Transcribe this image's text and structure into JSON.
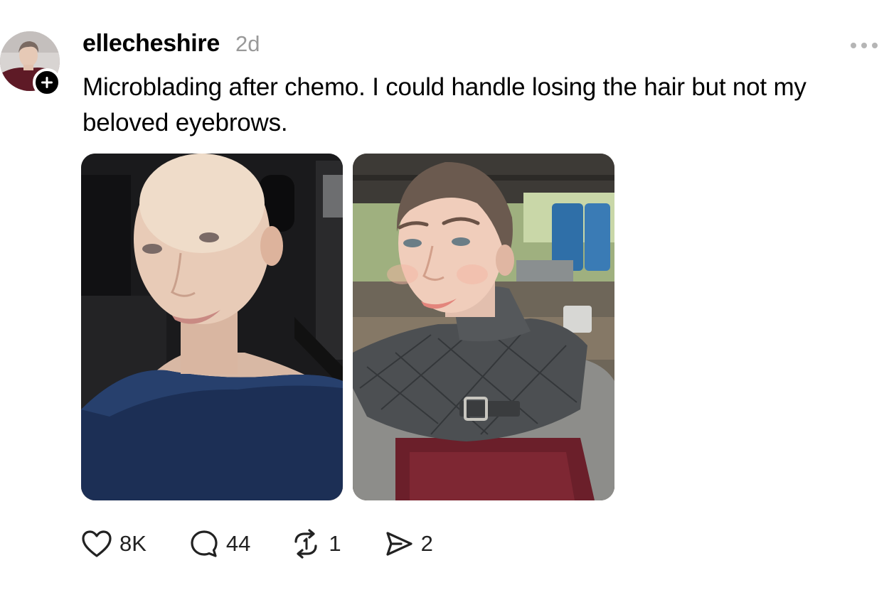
{
  "post": {
    "username": "ellecheshire",
    "timestamp": "2d",
    "caption": "Microblading after chemo. I could handle losing the hair but not my beloved eyebrows.",
    "images": [
      {
        "icon": "photo-before-chemo"
      },
      {
        "icon": "photo-after-microblading"
      }
    ]
  },
  "actions": {
    "likes": "8K",
    "replies": "44",
    "reposts": "1",
    "shares": "2"
  },
  "icons": {
    "more": "more-horizontal-icon",
    "follow": "plus-icon",
    "like": "heart-icon",
    "reply": "comment-bubble-icon",
    "repost": "repost-icon",
    "share": "send-icon"
  },
  "colors": {
    "text": "#000000",
    "muted": "#999999",
    "dots": "#b5b5b5",
    "badge": "#000000"
  }
}
